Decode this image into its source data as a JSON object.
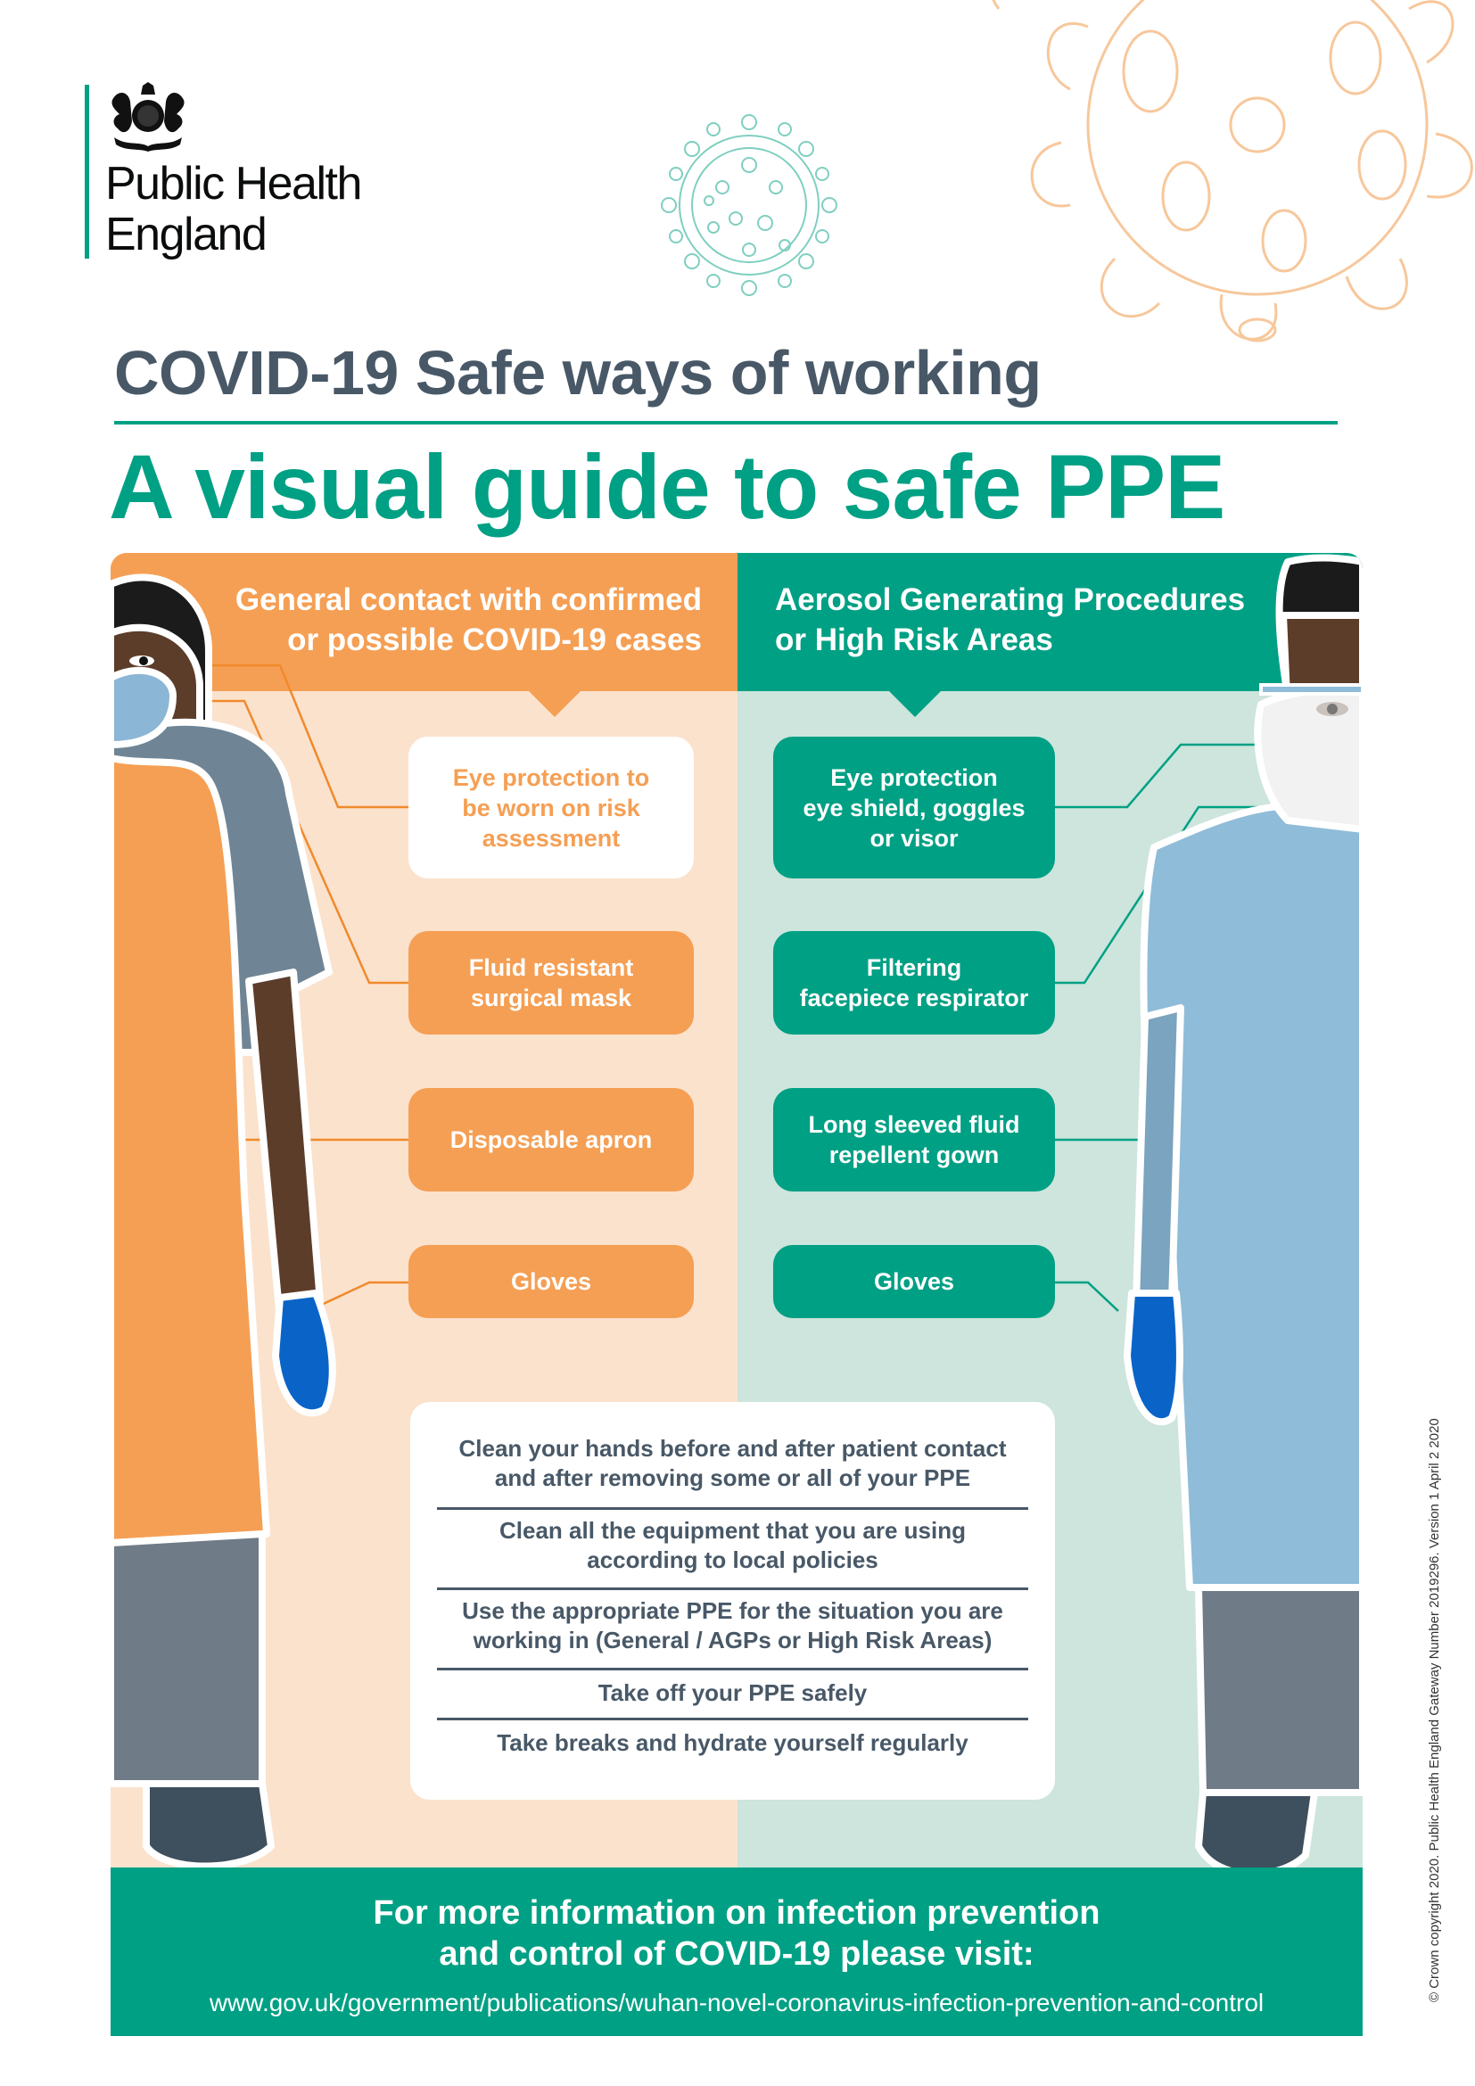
{
  "organisation": {
    "name": "Public Health\nEngland",
    "logo_icon": "royal-coat-of-arms-icon",
    "accent_color": "#00a084"
  },
  "header": {
    "subtitle": "COVID-19 Safe ways of working",
    "title": "A visual guide to safe PPE"
  },
  "colors": {
    "orange": "#f59f54",
    "orange_light": "#fbe2cd",
    "teal": "#00a084",
    "teal_light": "#cde5dc",
    "slate": "#485867"
  },
  "columns": {
    "general": {
      "heading": "General contact with confirmed\nor possible COVID-19 cases",
      "items": [
        {
          "label": "Eye protection to\nbe worn on risk\nassessment",
          "style": "outline"
        },
        {
          "label": "Fluid resistant\nsurgical mask",
          "style": "filled"
        },
        {
          "label": "Disposable apron",
          "style": "filled"
        },
        {
          "label": "Gloves",
          "style": "filled"
        }
      ]
    },
    "aerosol": {
      "heading": "Aerosol Generating Procedures\nor High Risk Areas",
      "items": [
        {
          "label": "Eye protection\neye shield, goggles\nor visor",
          "style": "filled"
        },
        {
          "label": "Filtering\nfacepiece respirator",
          "style": "filled"
        },
        {
          "label": "Long sleeved fluid\nrepellent gown",
          "style": "filled"
        },
        {
          "label": "Gloves",
          "style": "filled"
        }
      ]
    }
  },
  "advice": [
    "Clean your hands before and after patient contact\nand after removing some or all of your PPE",
    "Clean all the equipment that you are using\naccording to local policies",
    "Use the appropriate PPE for the situation you are\nworking in (General / AGPs or High Risk Areas)",
    "Take off your PPE safely",
    "Take breaks and hydrate yourself regularly"
  ],
  "footer": {
    "text": "For more information on infection prevention\nand control of COVID-19 please visit:",
    "url": "www.gov.uk/government/publications/wuhan-novel-coronavirus-infection-prevention-and-control"
  },
  "copyright": "© Crown copyright 2020. Public Health England Gateway Number 2019296. Version 1 April 2 2020"
}
